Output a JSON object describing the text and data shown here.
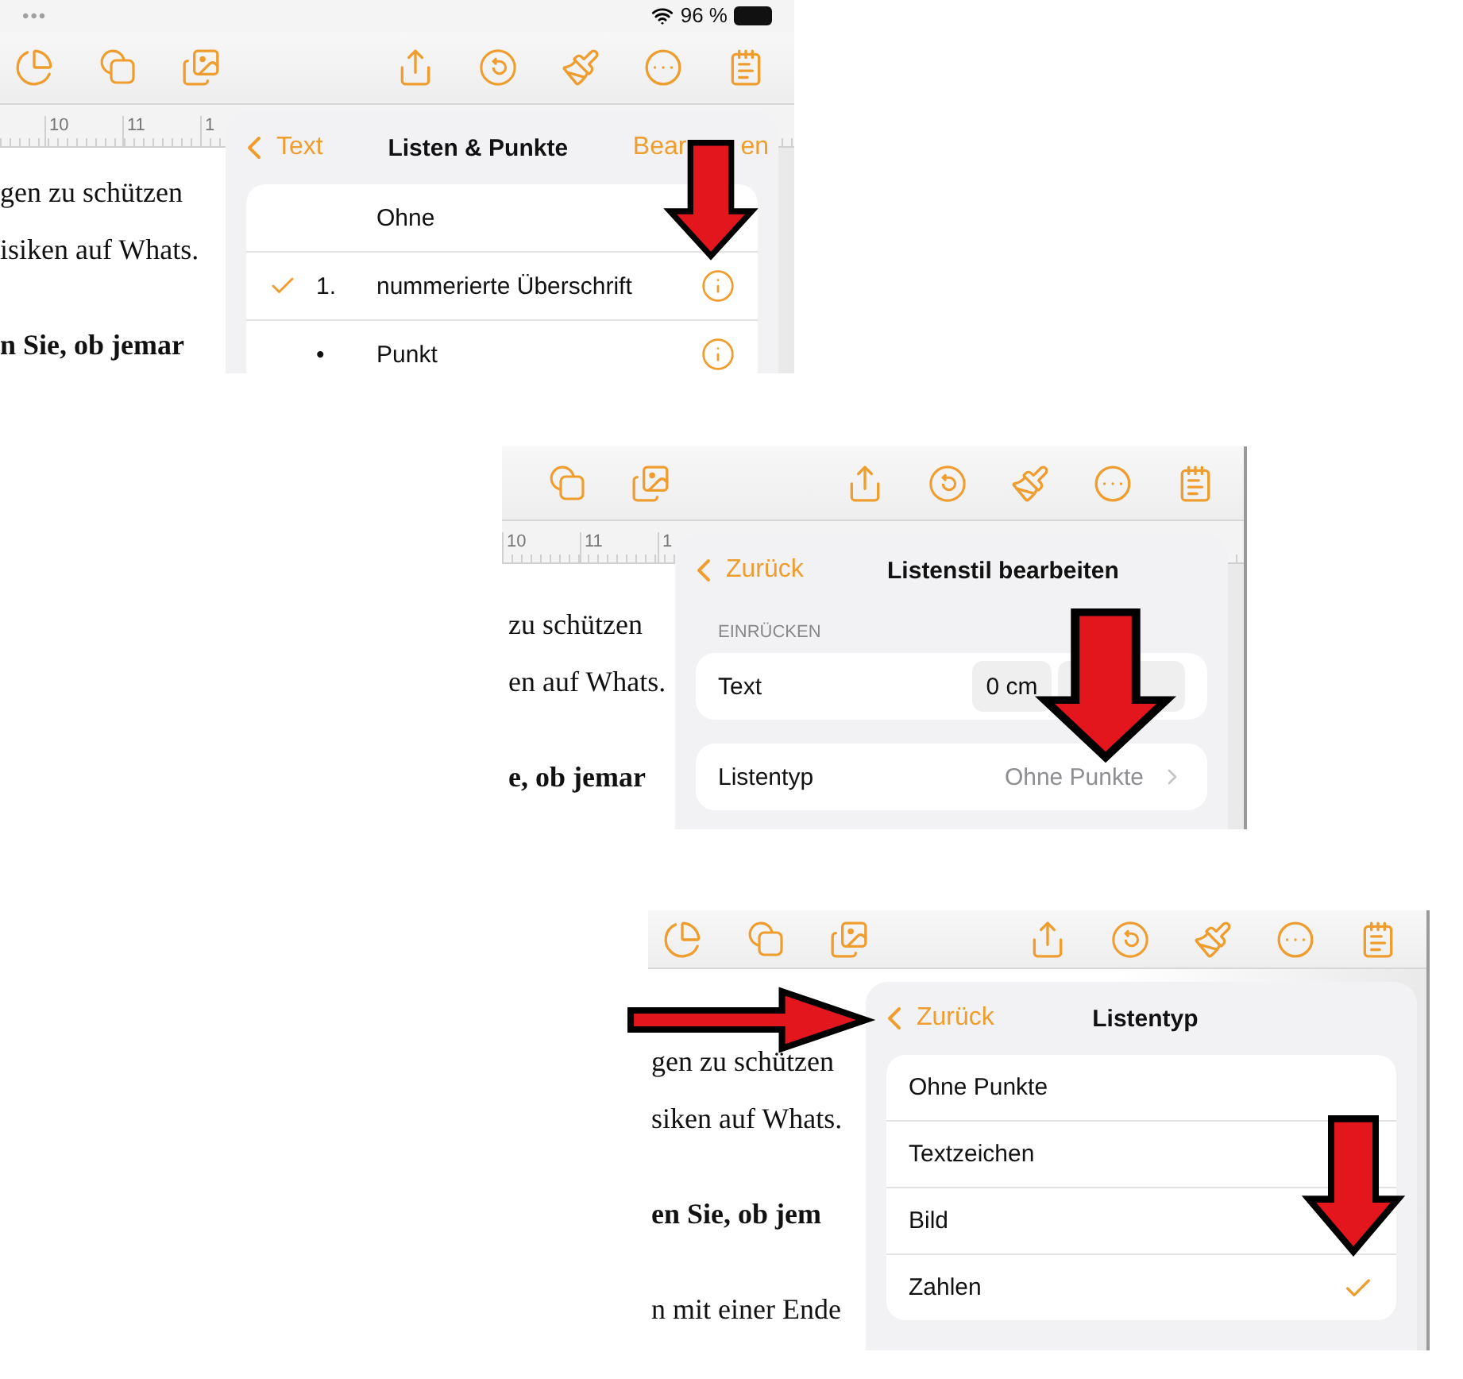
{
  "screenshots": [
    {
      "status_bar": {
        "dots": "•••",
        "battery_text": "96 %"
      },
      "toolbar": {
        "kind": "full"
      },
      "ruler": [
        "10",
        "11",
        "1"
      ],
      "document_lines": [
        {
          "text": "gen zu schützen",
          "bold": false
        },
        {
          "text": "isiken auf Whats.",
          "bold": false
        },
        {
          "text": "n Sie, ob jemar",
          "bold": true
        }
      ],
      "popover": {
        "kind": "styles",
        "back": "Text",
        "title": "Listen & Punkte",
        "action_parts": [
          "Bear",
          "en"
        ],
        "rows": [
          {
            "marker": "",
            "label": "Ohne",
            "selected": false
          },
          {
            "marker": "1.",
            "label": "nummerierte Überschrift",
            "selected": true,
            "info": true
          },
          {
            "marker": "•",
            "label": "Punkt",
            "selected": false,
            "info": true
          }
        ]
      }
    },
    {
      "toolbar": {
        "kind": "cropped"
      },
      "ruler": [
        "10",
        "11",
        "1"
      ],
      "document_lines": [
        {
          "text": "zu schützen",
          "bold": false
        },
        {
          "text": "en auf Whats.",
          "bold": false
        },
        {
          "text": "e, ob jemar",
          "bold": true
        }
      ],
      "popover": {
        "kind": "edit",
        "back": "Zurück",
        "title": "Listenstil bearbeiten",
        "section": "EINRÜCKEN",
        "indent": {
          "label": "Text",
          "value": "0 cm"
        },
        "list_type": {
          "label": "Listentyp",
          "value": "Ohne Punkte"
        }
      }
    },
    {
      "toolbar": {
        "kind": "full"
      },
      "document_lines": [
        {
          "text": "gen zu schützen",
          "bold": false
        },
        {
          "text": "siken auf Whats.",
          "bold": false
        },
        {
          "text": "en Sie, ob jem",
          "bold": true
        },
        {
          "text": "n mit einer Ende",
          "bold": false
        }
      ],
      "popover": {
        "kind": "types",
        "back": "Zurück",
        "title": "Listentyp",
        "rows": [
          {
            "label": "Ohne Punkte",
            "selected": false
          },
          {
            "label": "Textzeichen",
            "selected": false
          },
          {
            "label": "Bild",
            "selected": false
          },
          {
            "label": "Zahlen",
            "selected": true
          }
        ]
      }
    }
  ]
}
